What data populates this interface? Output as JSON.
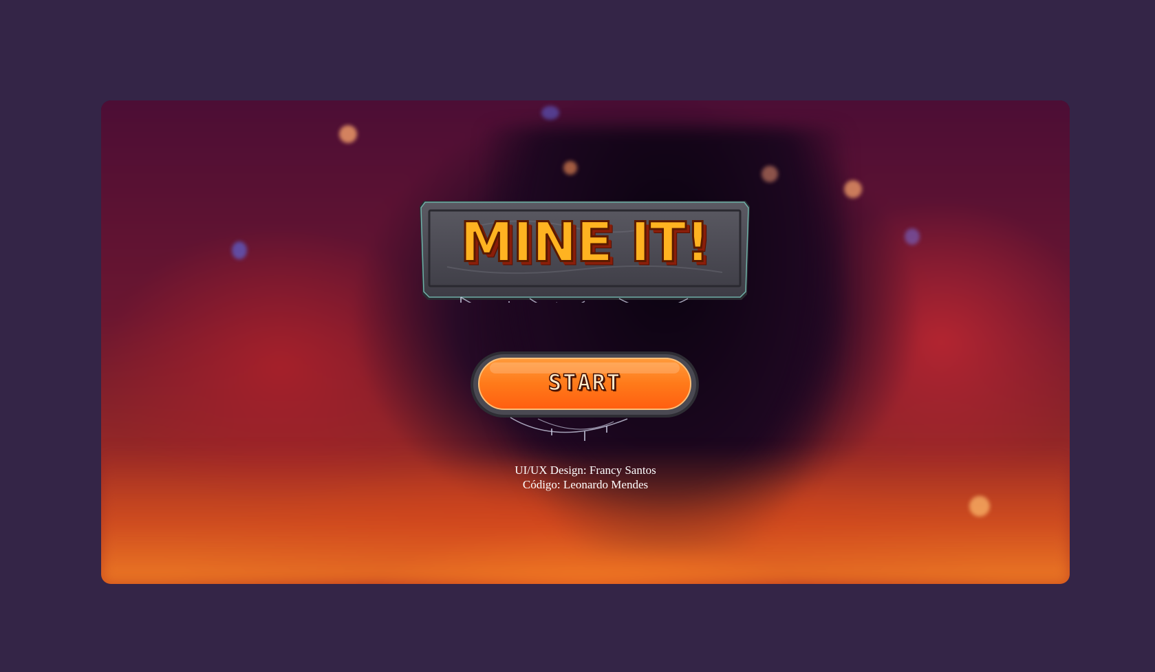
{
  "game": {
    "title": "MINE IT!",
    "start_label": "START"
  },
  "credits": {
    "design": "UI/UX Design: Francy Santos",
    "code": "Código: Leonardo Mendes"
  },
  "colors": {
    "page_background": "#342547",
    "title_fill": "#ffb321",
    "title_shadow": "#8a1e0a",
    "button_orange": "#ff7a1a",
    "board_stone": "#4a4952"
  }
}
